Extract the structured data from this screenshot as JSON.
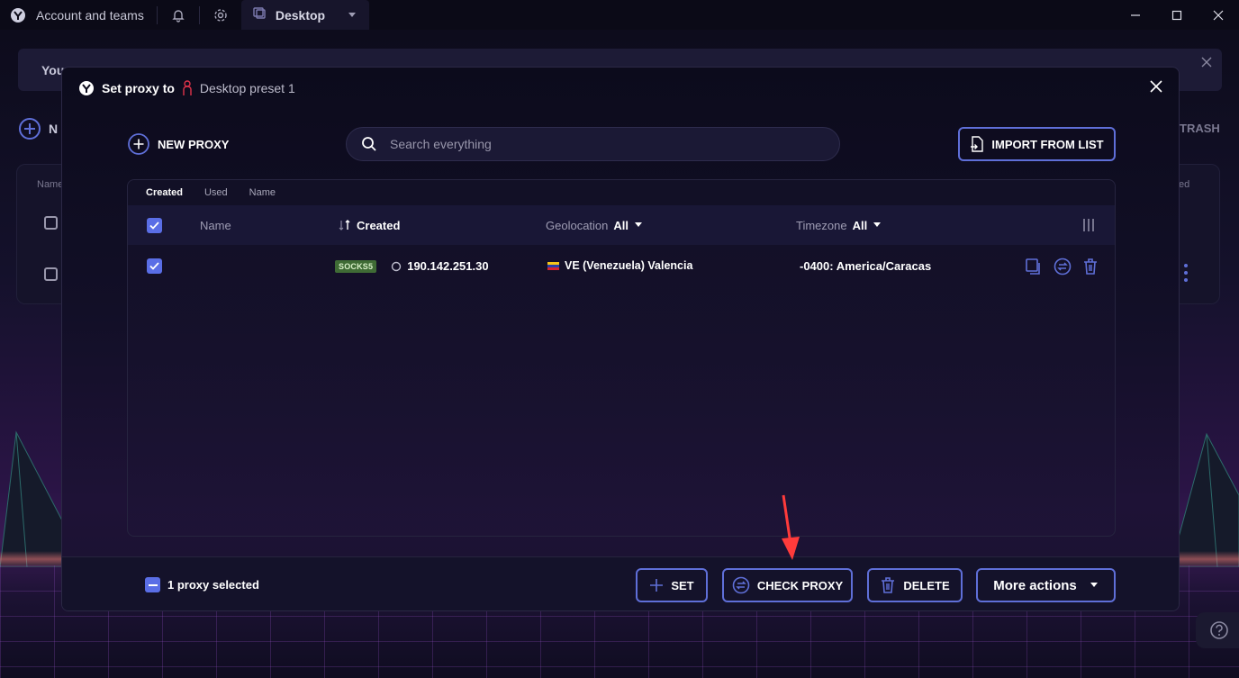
{
  "titlebar": {
    "account": "Account and teams",
    "tab_label": "Desktop"
  },
  "background_page": {
    "notice_text": "You",
    "new_label": "N",
    "trash_label": "TRASH",
    "col_name": "Name",
    "col_right": "ed"
  },
  "modal": {
    "title": "Set proxy to",
    "preset": "Desktop preset 1",
    "new_proxy": "NEW PROXY",
    "search_placeholder": "Search everything",
    "import_label": "IMPORT FROM LIST",
    "sort_tabs": [
      "Created",
      "Used",
      "Name"
    ],
    "columns": {
      "name": "Name",
      "created": "Created",
      "geolocation": "Geolocation",
      "geolocation_filter": "All",
      "timezone": "Timezone",
      "timezone_filter": "All"
    },
    "rows": [
      {
        "type": "SOCKS5",
        "ip": "190.142.251.30",
        "geo": "VE (Venezuela) Valencia",
        "timezone": "-0400: America/Caracas"
      }
    ],
    "footer": {
      "selected_text": "1 proxy selected",
      "set": "SET",
      "check_proxy": "CHECK PROXY",
      "delete": "DELETE",
      "more_actions": "More actions"
    }
  },
  "colors": {
    "accent": "#5a6ee6",
    "button_border": "#5f6fd8",
    "badge_bg": "#3f6b35",
    "annotation_arrow": "#ff3b3b"
  }
}
